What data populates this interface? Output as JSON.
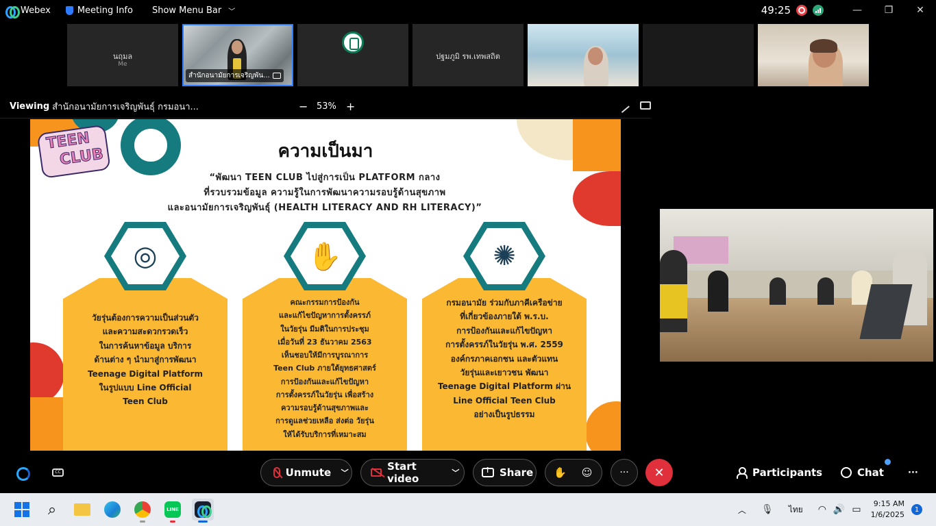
{
  "titlebar": {
    "app_name": "Webex",
    "meeting_info": "Meeting Info",
    "show_menu_bar": "Show Menu Bar",
    "timer": "49:25",
    "minimize": "—",
    "maximize": "❐",
    "close": "✕"
  },
  "thumbnails": [
    {
      "name": "นฤมล",
      "sub": "Me"
    },
    {
      "name": "สำนักอนามัยการเจริญพัน..."
    },
    {
      "name": ""
    },
    {
      "name": "ปฐมภูมิ รพ.เทพสถิต"
    },
    {
      "name": ""
    },
    {
      "name": ""
    },
    {
      "name": ""
    }
  ],
  "viewbar": {
    "viewing_label": "Viewing",
    "viewing_name": "สำนักอนามัยการเจริญพันธุ์ กรมอนา...",
    "zoom_minus": "−",
    "zoom_level": "53%",
    "zoom_plus": "+"
  },
  "slide": {
    "logo_line1": "TEEN",
    "logo_line2": "CLUB",
    "title": "ความเป็นมา",
    "subtitle_lines": [
      "“พัฒนา TEEN CLUB ไปสู่การเป็น PLATFORM กลาง",
      "ที่รวบรวมข้อมูล ความรู้ในการพัฒนาความรอบรู้ด้านสุขภาพ",
      "และอนามัยการเจริญพันธุ์ (HEALTH LITERACY AND RH LITERACY)”"
    ],
    "cards": [
      {
        "icon": "target-person-icon",
        "lines": [
          "วัยรุ่นต้องการความเป็นส่วนตัว",
          "และความสะดวกรวดเร็ว",
          "ในการค้นหาข้อมูล บริการ",
          "ด้านต่าง ๆ นำมาสู่การพัฒนา",
          "Teenage Digital Platform",
          "ในรูปแบบ Line Official",
          "Teen Club"
        ]
      },
      {
        "icon": "puzzle-hands-icon",
        "lines": [
          "คณะกรรมการป้องกัน",
          "และแก้ไขปัญหาการตั้งครรภ์",
          "ในวัยรุ่น มีมติในการประชุม",
          "เมื่อวันที่ 23 ธันวาคม 2563",
          "เห็นชอบให้มีการบูรณาการ",
          "Teen Club ภายใต้ยุทธศาสตร์",
          "การป้องกันและแก้ไขปัญหา",
          "การตั้งครรภ์ในวัยรุ่น เพื่อสร้าง",
          "ความรอบรู้ด้านสุขภาพและ",
          "การดูแลช่วยเหลือ ส่งต่อ วัยรุ่น",
          "ให้ได้รับบริการที่เหมาะสม"
        ]
      },
      {
        "icon": "globe-network-icon",
        "lines": [
          "กรมอนามัย ร่วมกับภาคีเครือข่าย",
          "ที่เกี่ยวข้องภายใต้ พ.ร.บ.",
          "การป้องกันและแก้ไขปัญหา",
          "การตั้งครรภ์ในวัยรุ่น พ.ศ. 2559",
          "องค์กรภาคเอกชน และตัวแทน",
          "วัยรุ่นและเยาวชน พัฒนา",
          "Teenage Digital Platform ผ่าน",
          "Line Official Teen Club",
          "อย่างเป็นรูปธรรม"
        ]
      }
    ]
  },
  "controls": {
    "unmute": "Unmute",
    "start_video": "Start video",
    "share": "Share",
    "more": "···",
    "participants": "Participants",
    "chat": "Chat",
    "overflow": "···"
  },
  "taskbar": {
    "language": "ไทย",
    "time": "9:15 AM",
    "date": "1/6/2025",
    "notifications": "1"
  },
  "colors": {
    "accent_blue": "#2e7cff",
    "end_red": "#e0303b",
    "card_yellow": "#fbb933",
    "hex_teal": "#167b7e",
    "deco_orange": "#f7941d",
    "deco_red": "#e03a2f"
  }
}
